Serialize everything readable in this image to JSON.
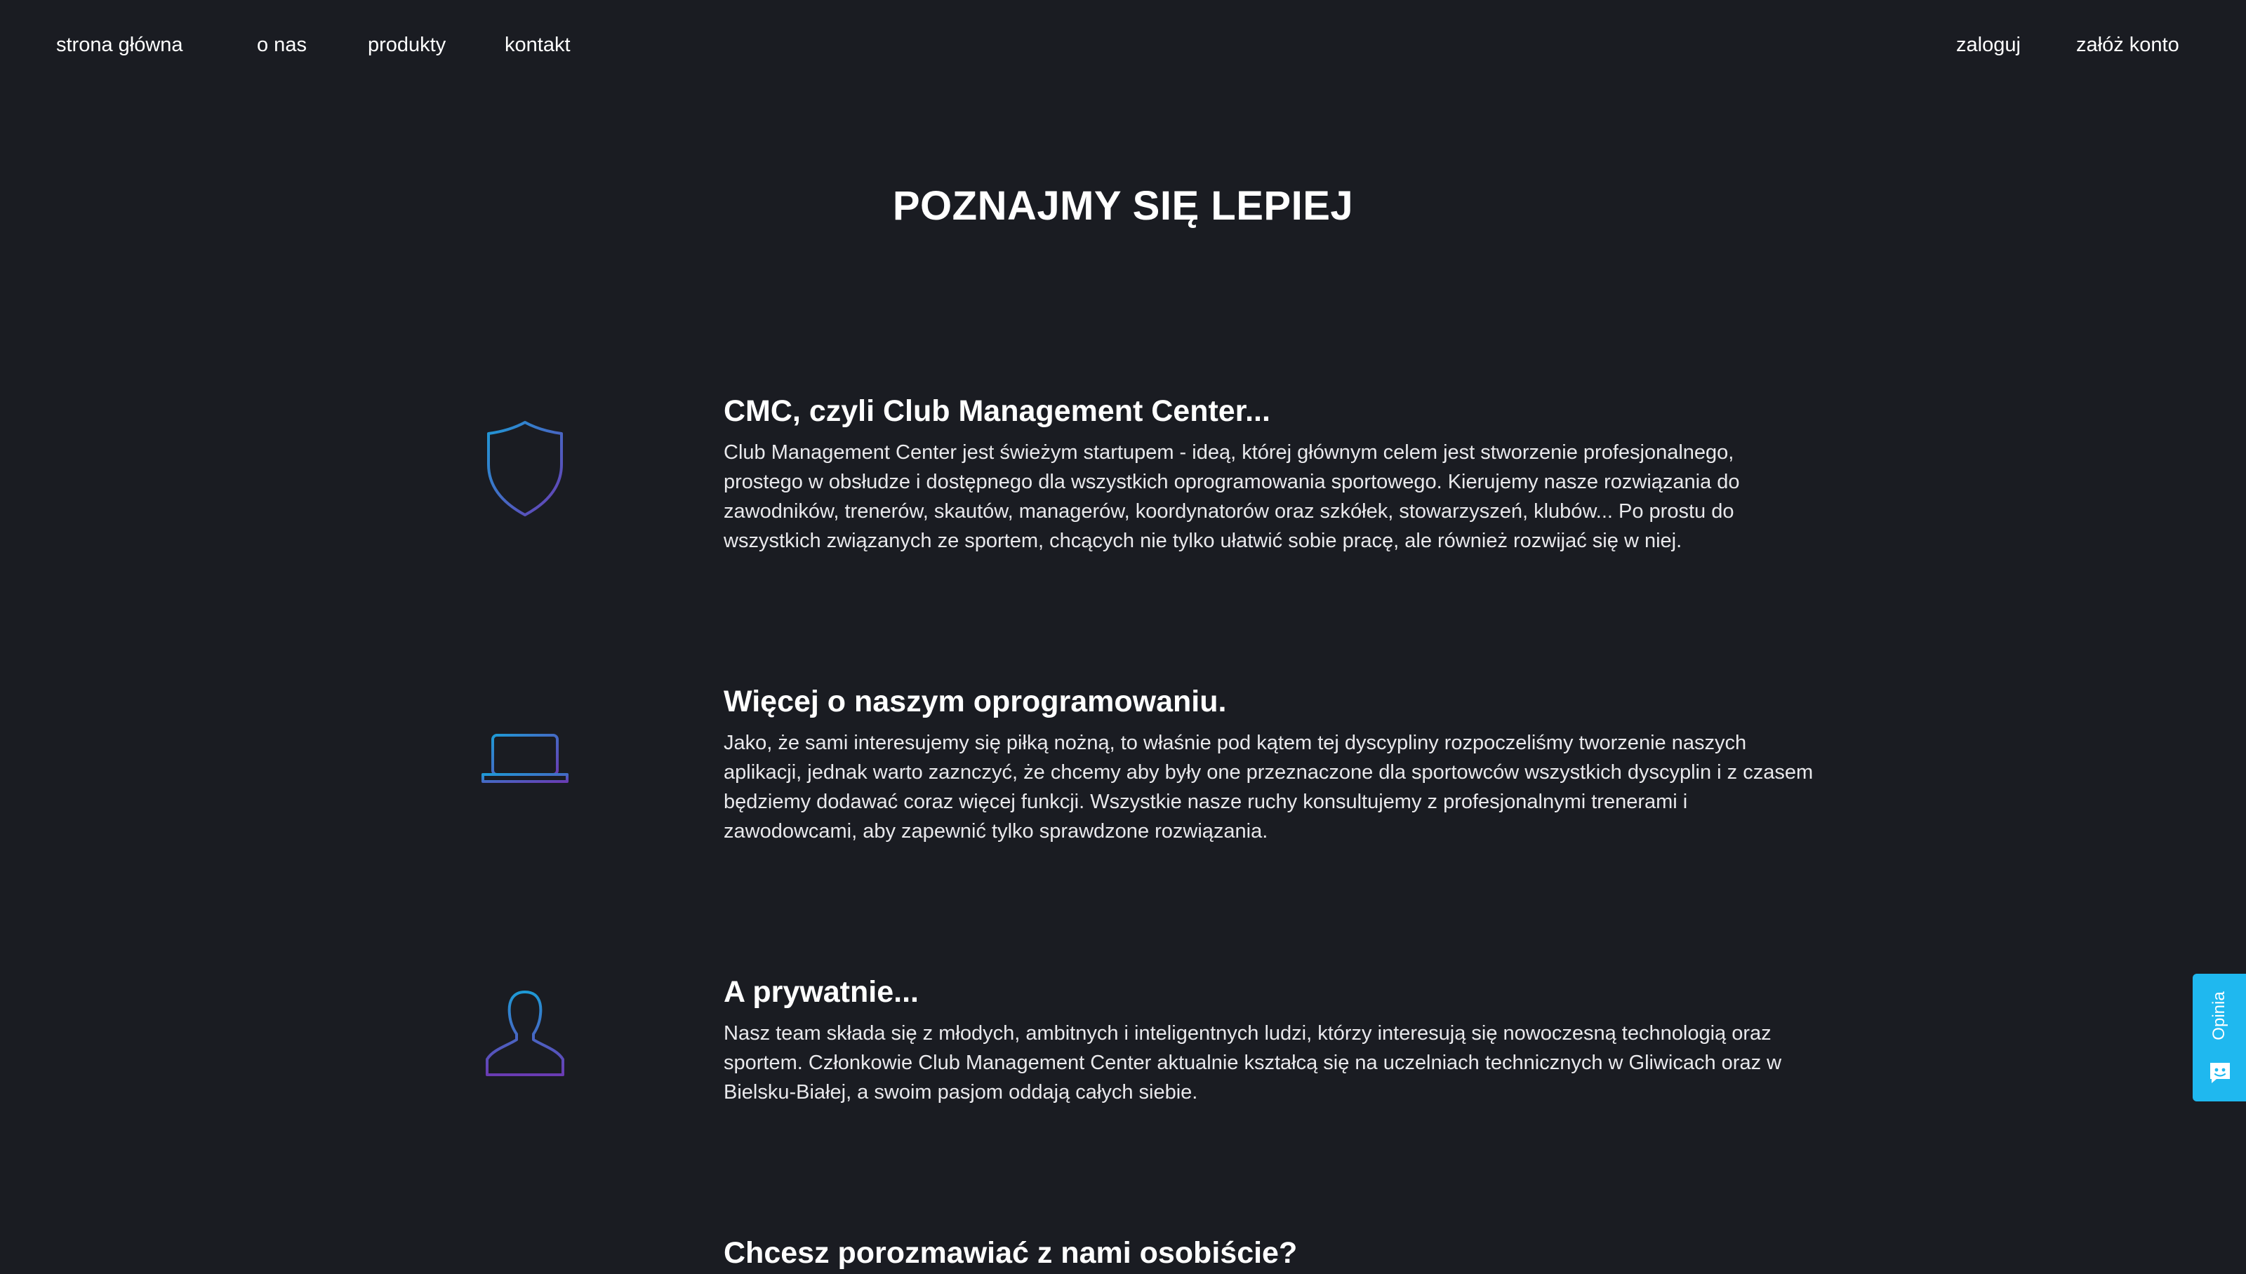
{
  "nav": {
    "left": [
      {
        "label": "strona główna"
      },
      {
        "label": "o nas"
      },
      {
        "label": "produkty"
      },
      {
        "label": "kontakt"
      }
    ],
    "right": [
      {
        "label": "zaloguj"
      },
      {
        "label": "załóż konto"
      }
    ]
  },
  "page_title": "POZNAJMY SIĘ LEPIEJ",
  "sections": [
    {
      "icon": "shield-icon",
      "heading": "CMC, czyli Club Management Center...",
      "lines": [
        "Club Management Center jest świeżym startupem - ideą, której głównym celem jest stworzenie profesjonalnego,",
        "prostego w obsłudze i dostępnego dla wszystkich oprogramowania sportowego. Kierujemy nasze rozwiązania do",
        "zawodników, trenerów, skautów, managerów, koordynatorów oraz szkółek, stowarzyszeń, klubów... Po prostu do",
        "wszystkich związanych ze sportem, chcących nie tylko ułatwić sobie pracę, ale również rozwijać się w niej."
      ]
    },
    {
      "icon": "laptop-icon",
      "heading": "Więcej o naszym oprogramowaniu.",
      "lines": [
        "Jako, że sami interesujemy się piłką nożną, to właśnie pod kątem tej dyscypliny rozpoczeliśmy tworzenie naszych",
        "aplikacji, jednak warto zaznczyć, że chcemy aby były one przeznaczone dla sportowców wszystkich dyscyplin i z czasem",
        "będziemy dodawać coraz więcej funkcji. Wszystkie nasze ruchy konsultujemy z profesjonalnymi trenerami i",
        "zawodowcami, aby zapewnić tylko sprawdzone rozwiązania."
      ]
    },
    {
      "icon": "person-icon",
      "heading": "A prywatnie...",
      "lines": [
        "Nasz team składa się z młodych, ambitnych i inteligentnych ludzi, którzy interesują się nowoczesną technologią oraz",
        "sportem. Członkowie Club Management Center aktualnie kształcą się na uczelniach technicznych w Gliwicach oraz w",
        "Bielsku-Białej, a swoim pasjom oddają całych siebie."
      ]
    },
    {
      "heading": "Chcesz porozmawiać z nami osobiście?"
    }
  ],
  "feedback": {
    "label": "Opinia",
    "icon": "chat-icon",
    "color": "#1fb8ef"
  },
  "colors": {
    "background": "#1a1c22",
    "icon_gradient_start": "#1e9ad6",
    "icon_gradient_end": "#6a3bb3"
  }
}
